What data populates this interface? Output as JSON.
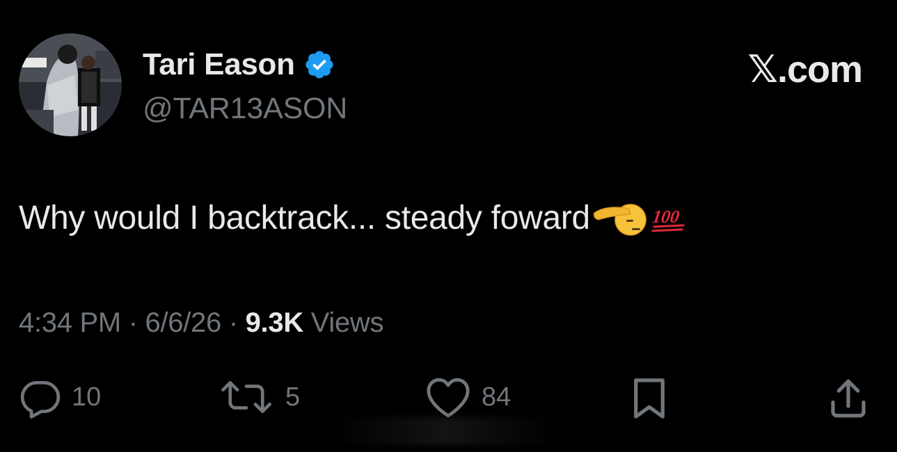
{
  "author": {
    "name": "Tari Eason",
    "handle": "@TAR13ASON",
    "verified": true,
    "avatar_icon": "profile-photo"
  },
  "brand": "𝕏.com",
  "tweet": {
    "text": "Why would I backtrack... steady foward",
    "emojis": [
      "saluting-face-emoji",
      "hundred-points-emoji"
    ],
    "emoji_hundred_text": "100"
  },
  "meta": {
    "time": "4:34 PM",
    "sep1": " · ",
    "date": "6/6/26",
    "sep2": " · ",
    "views_count": "9.3K",
    "views_label": " Views"
  },
  "actions": {
    "replies": "10",
    "reposts": "5",
    "likes": "84"
  },
  "colors": {
    "background": "#000000",
    "primary_text": "#e7e9ea",
    "secondary_text": "#71767b",
    "verified": "#1d9bf0",
    "hundred_red": "#e0293b"
  }
}
